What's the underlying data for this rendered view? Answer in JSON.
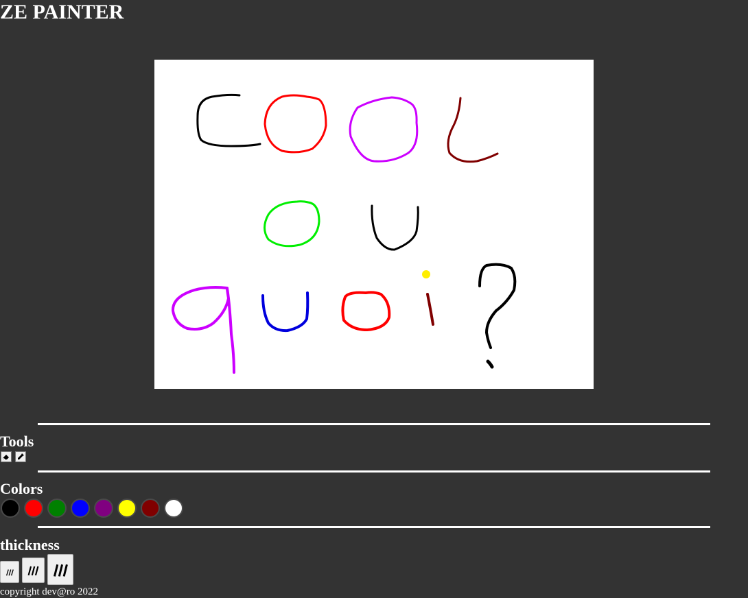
{
  "app": {
    "title": "ZE PAINTER"
  },
  "canvas": {
    "background": "#ffffff",
    "drawn_text": "COOL OU QUOI?"
  },
  "tools": {
    "heading": "Tools",
    "items": [
      {
        "name": "eraser",
        "icon": "eraser-icon"
      },
      {
        "name": "color-picker",
        "icon": "eyedropper-icon"
      }
    ]
  },
  "colors": {
    "heading": "Colors",
    "swatches": [
      "#000000",
      "#ff0000",
      "#008000",
      "#0000ff",
      "#800080",
      "#ffff00",
      "#800000",
      "#ffffff"
    ]
  },
  "thickness": {
    "heading": "thickness",
    "options": [
      {
        "name": "thin",
        "icon": "thin-lines-icon"
      },
      {
        "name": "medium",
        "icon": "medium-lines-icon"
      },
      {
        "name": "thick",
        "icon": "thick-lines-icon"
      }
    ]
  },
  "footer": {
    "copyright": "copyright dev@ro 2022"
  }
}
